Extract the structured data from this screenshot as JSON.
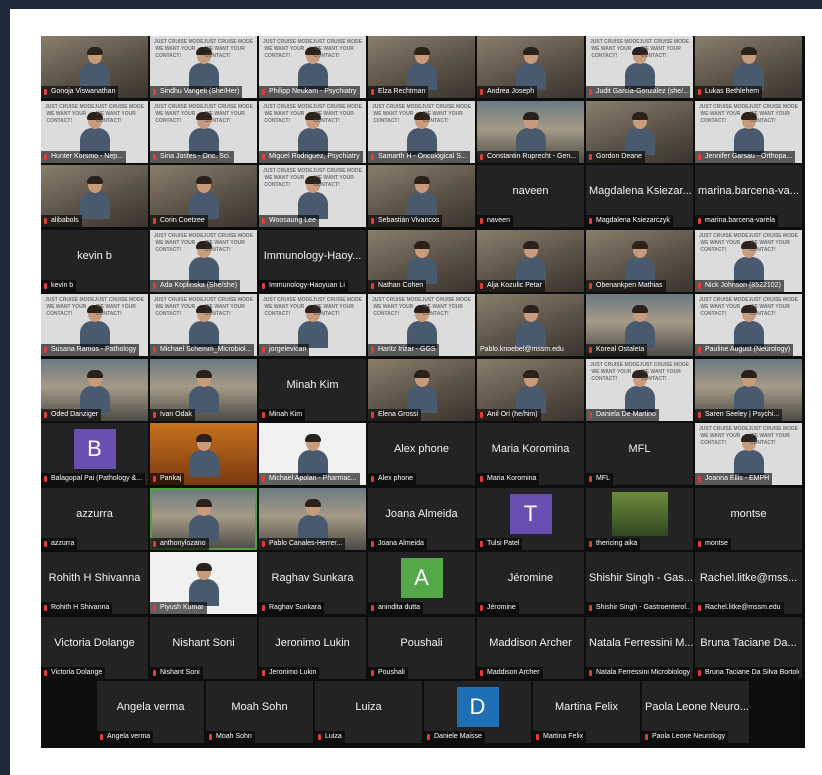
{
  "meeting": {
    "accent": "#1f2a3d",
    "active_border": "#4fa13b"
  },
  "rows": [
    [
      "Gonoja Viswanathan",
      "Sindhu Vangeti (She/Her)",
      "Philipp Neukam - Psychiatry",
      "Elza Rechtman",
      "Andrea Joseph",
      "Judit García-González (she/...",
      "Lukas Bethlehem"
    ],
    [
      "Hunter Korsmo - Nep...",
      "Sina Jostes - Onc. Sci.",
      "Miguel Rodriguez, Psychiatry",
      "Samarth H - Oncological S...",
      "Constantin Ruprecht - Gen...",
      "Gordon Deane",
      "Jennifer Garsau - Orthopa..."
    ],
    [
      "alibabols",
      "Corin Coetzee",
      "Woosaung Lee",
      "Sebastián Vivancos",
      "naveen",
      "Magdalena Ksiezarczyk",
      "marina.barcena-varela"
    ],
    [
      "kevin b",
      "Ada Koplinska (She/she)",
      "Immunology-Haoyuan Li",
      "Nathan Cohen",
      "Alja Kozulic Petar",
      "Obenankpen Mathias",
      "Nick Johnson (8522102)"
    ],
    [
      "Susana Ramos - Pathology",
      "Michael Schemm_Microbiol...",
      "jorgelevican",
      "Haritz Irizar - GGS",
      "Pablo.knoebel@mssm.edu",
      "Koreal Ostaleta",
      "Pauline August (Neurology)"
    ],
    [
      "Oded Danziger",
      "Ivan Odak",
      "Minah Kim",
      "Elena Grossi",
      "Anil Ori (he/him)",
      "Daniela De Martino",
      "Saren Seeley | Psychi..."
    ],
    [
      "Balagopal Pai (Pathology &...",
      "Pankaj",
      "Michael Apolan - Pharmac...",
      "Alex phone",
      "Maria Koromina",
      "MFL",
      "Joanna Ellis - EMPH"
    ],
    [
      "azzurra",
      "anthonylozano",
      "Pablo Canales-Herrer...",
      "Joana Almeida",
      "Tulsi Patel",
      "thericing aika",
      "montse"
    ],
    [
      "Rohith H Shivanna",
      "Piyush Kumar",
      "Raghav Sunkara",
      "anindita dutta",
      "Jéromine",
      "Shishir Singh - Gastroenterol...",
      "Rachel.litke@mssm.edu"
    ],
    [
      "Victoria Dolange",
      "Nishant Soni",
      "Jeronimo Lukin",
      "Poushali",
      "Maddison Archer",
      "Natala Ferressini Microbiology",
      "Bruna Taciane Da Silva Bortolet"
    ],
    [
      "Angela verma",
      "Moah Sohn",
      "Luiza",
      "Daniele Maisse",
      "Martina Felix",
      "Paola Leone Neurology"
    ]
  ],
  "display": {
    "naveen": "naveen",
    "Magdalena Ksiezarczyk": "Magdalena Ksiezar...",
    "marina.barcena-varela": "marina.barcena-va...",
    "kevin b": "kevin b",
    "Immunology-Haoyuan Li": "Immunology-Haoy...",
    "Minah Kim": "Minah Kim",
    "Alex phone": "Alex phone",
    "Maria Koromina": "Maria Koromina",
    "MFL": "MFL",
    "azzurra": "azzurra",
    "Joana Almeida": "Joana Almeida",
    "montse": "montse",
    "Rohith H Shivanna": "Rohith H Shivanna",
    "Raghav Sunkara": "Raghav Sunkara",
    "Jéromine": "Jéromine",
    "Shishir Singh - Gastroenterol...": "Shishir Singh - Gas...",
    "Rachel.litke@mssm.edu": "Rachel.litke@mss...",
    "Victoria Dolange": "Victoria Dolange",
    "Nishant Soni": "Nishant Soni",
    "Jeronimo Lukin": "Jeronimo Lukin",
    "Poushali": "Poushali",
    "Maddison Archer": "Maddison Archer",
    "Natala Ferressini Microbiology": "Natala Ferressini M...",
    "Bruna Taciane Da Silva Bortolet": "Bruna Taciane Da...",
    "Angela verma": "Angela verma",
    "Moah Sohn": "Moah Sohn",
    "Luiza": "Luiza",
    "Martina Felix": "Martina Felix",
    "Paola Leone Neurology": "Paola Leone Neuro..."
  },
  "avatars": {
    "Balagopal Pai (Pathology &...": {
      "letter": "B",
      "color": "#6a4fb3"
    },
    "Tulsi Patel": {
      "letter": "T",
      "color": "#6a4fb3"
    },
    "anindita dutta": {
      "letter": "A",
      "color": "#55a84a"
    },
    "Daniele Maisse": {
      "letter": "D",
      "color": "#1f6fb5"
    }
  }
}
